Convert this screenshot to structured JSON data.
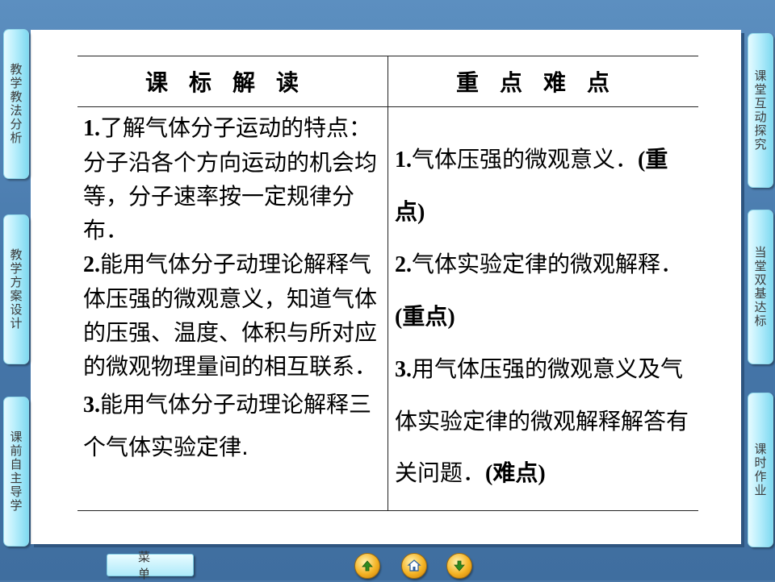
{
  "sidebar_left": [
    {
      "label": "教学教法分析"
    },
    {
      "label": "教学方案设计"
    },
    {
      "label": "课前自主导学"
    }
  ],
  "sidebar_right": [
    {
      "label": "课堂互动探究"
    },
    {
      "label": "当堂双基达标"
    },
    {
      "label": "课时作业"
    }
  ],
  "table": {
    "header_left": "课标解读",
    "header_right": "重点难点",
    "left_items": [
      {
        "num": "1.",
        "text": "了解气体分子运动的特点：分子沿各个方向运动的机会均等，分子速率按一定规律分布．"
      },
      {
        "num": "2.",
        "text": "能用气体分子动理论解释气体压强的微观意义，知道气体的压强、温度、体积与所对应的微观物理量间的相互联系．"
      },
      {
        "num": "3.",
        "text": "能用气体分子动理论解释三个气体实验定律."
      }
    ],
    "right_items": [
      {
        "num": "1.",
        "text": "气体压强的微观意义．",
        "tag": "(重点)"
      },
      {
        "num": "2.",
        "text": "气体实验定律的微观解释．",
        "tag": "(重点)"
      },
      {
        "num": "3.",
        "text": "用气体压强的微观意义及气体实验定律的微观解释解答有关问题．",
        "tag": "(难点)"
      }
    ]
  },
  "bottom": {
    "menu_label": "菜单",
    "nav": [
      {
        "icon": "arrow-up-icon"
      },
      {
        "icon": "home-icon"
      },
      {
        "icon": "arrow-down-icon"
      }
    ]
  },
  "colors": {
    "background": "#4a78a8",
    "tab": "#b8eefc",
    "nav_button": "#f4b324"
  }
}
